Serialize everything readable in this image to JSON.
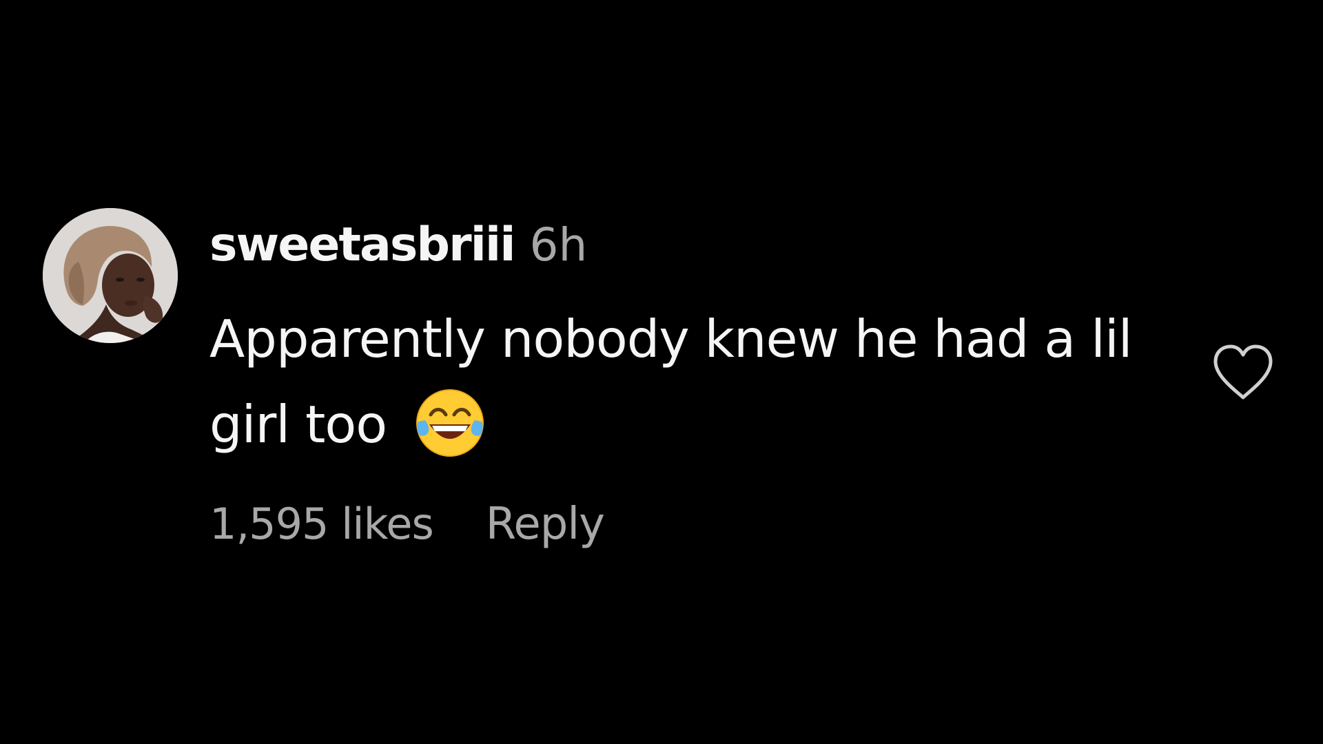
{
  "comment": {
    "username": "sweetasbriii",
    "time": "6h",
    "text": "Apparently nobody knew he had a lil girl too",
    "emoji": "face-with-tears-of-joy-icon",
    "likes": "1,595 likes",
    "reply_label": "Reply"
  },
  "colors": {
    "background": "#000000",
    "primary_text": "#f5f5f5",
    "secondary_text": "#a8a8a8"
  }
}
